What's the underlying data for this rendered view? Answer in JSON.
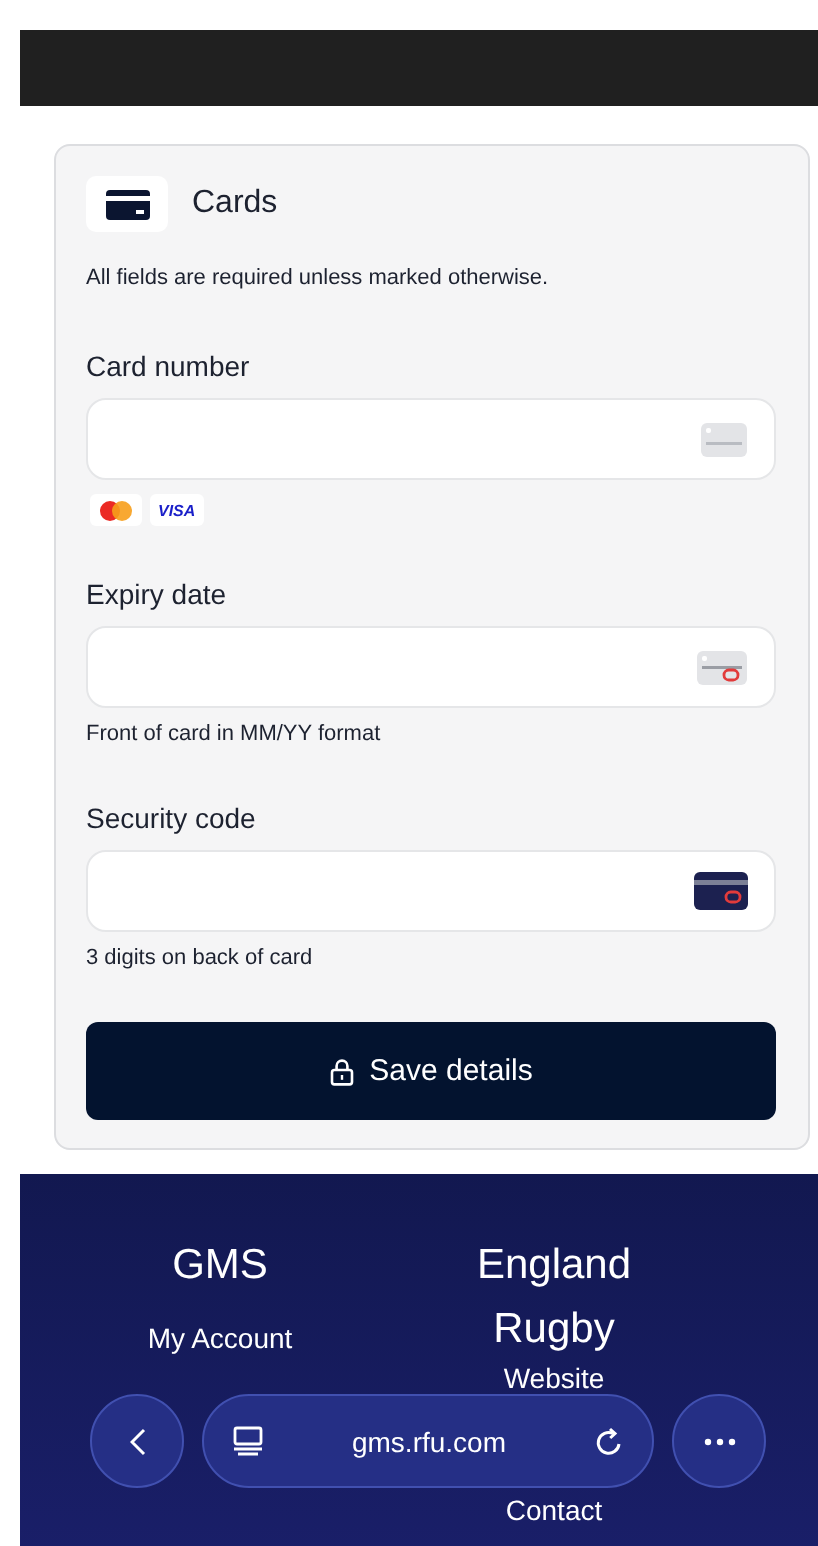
{
  "form": {
    "title": "Cards",
    "note": "All fields are required unless marked otherwise.",
    "fields": [
      {
        "label": "Card number",
        "kind": "number",
        "badges": [
          {
            "kind": "mastercard"
          },
          {
            "kind": "visa",
            "text": "VISA"
          }
        ]
      },
      {
        "label": "Expiry date",
        "kind": "expiry",
        "hint": "Front of card in MM/YY format"
      },
      {
        "label": "Security code",
        "kind": "cvc",
        "hint": "3 digits on back of card"
      }
    ],
    "button": "Save details"
  },
  "footer": {
    "columns": [
      {
        "heading": "GMS",
        "links": [
          "My Account"
        ]
      },
      {
        "heading": "England Rugby",
        "links": [
          "Website",
          "Contact"
        ]
      }
    ]
  },
  "browser_bar": {
    "url": "gms.rfu.com"
  }
}
